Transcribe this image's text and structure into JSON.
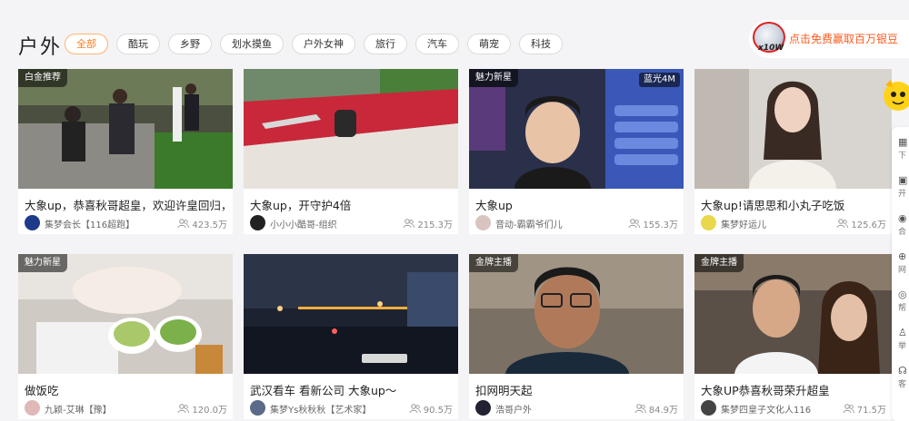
{
  "header": {
    "title": "户外",
    "filters": [
      "全部",
      "酷玩",
      "乡野",
      "划水摸鱼",
      "户外女神",
      "旅行",
      "汽车",
      "萌宠",
      "科技"
    ]
  },
  "promo": {
    "text": "点击免费赢取百万银豆",
    "coin_label": "x10W"
  },
  "cards": [
    {
      "badge": "白金推荐",
      "title": "大象up，恭喜秋哥超皇，欢迎许皇回归，",
      "anchor": "集梦会长【116超跑】",
      "viewers": "423.5万"
    },
    {
      "badge": "",
      "title": "大象up，开守护4倍",
      "anchor": "小小小酷哥-组织",
      "viewers": "215.3万"
    },
    {
      "badge": "魅力新星",
      "title": "大象up",
      "anchor": "音动-霸霸爷们儿",
      "viewers": "155.3万",
      "overlay": "蓝光4M"
    },
    {
      "badge": "",
      "title": "大象up!请思思和小丸子吃饭",
      "anchor": "集梦好运儿",
      "viewers": "125.6万"
    },
    {
      "badge": "魅力新星",
      "title": "做饭吃",
      "anchor": "九颖-艾琳【豫】",
      "viewers": "120.0万"
    },
    {
      "badge": "",
      "title": "武汉看车 看新公司 大象up～",
      "anchor": "集梦Ys秋秋秋【艺术家】",
      "viewers": "90.5万"
    },
    {
      "badge": "金牌主播",
      "title": "扣网明天起",
      "anchor": "浩哥户外",
      "viewers": "84.9万"
    },
    {
      "badge": "金牌主播",
      "title": "大象UP恭喜秋哥荣升超皇",
      "anchor": "集梦四皇子文化人116",
      "viewers": "71.5万"
    }
  ],
  "sidebar": {
    "items": [
      {
        "icon": "grid-icon",
        "label": "下"
      },
      {
        "icon": "download-icon",
        "label": "开"
      },
      {
        "icon": "location-icon",
        "label": "合"
      },
      {
        "icon": "plus-icon",
        "label": "网"
      },
      {
        "icon": "help-icon",
        "label": "帮"
      },
      {
        "icon": "share-icon",
        "label": "举"
      },
      {
        "icon": "headset-icon",
        "label": "客"
      }
    ]
  },
  "colors": {
    "accent": "#ff7a1a",
    "promo_text": "#ff5a1f",
    "background": "#f4f4f6"
  }
}
